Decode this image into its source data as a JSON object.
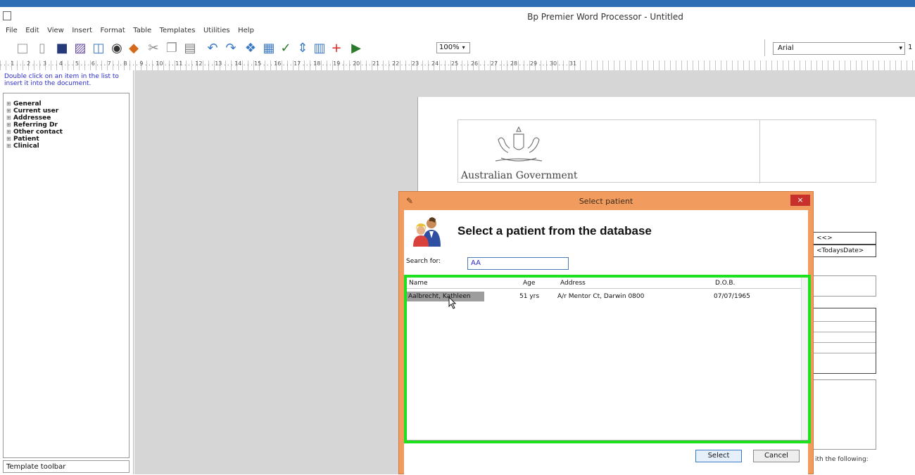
{
  "window": {
    "title": "Bp Premier Word Processor - Untitled"
  },
  "menu": [
    "File",
    "Edit",
    "View",
    "Insert",
    "Format",
    "Table",
    "Templates",
    "Utilities",
    "Help"
  ],
  "toolbar": {
    "zoom": "100%",
    "font": "Arial",
    "font_size": "1"
  },
  "ruler": {
    "marks": ". . . 1 . . . 2 . . . 3 . . . 4 . . . 5 . . . 6 . . . 7 . . . 8 . . . 9 . . . 10 . . . 11 . . . 12 . . . 13 . . . 14 . . . 15 . . . 16 . . . 17 . . . 18 . . . 19 . . . 20 . . . 21 . . . 22 . . . 23 . . . 24 . . . 25 . . . 26 . . . 27 . . . 28 . . . 29 . . . 30 . . . 31"
  },
  "left_panel": {
    "hint": "Double click on an item in the list to insert it into the document.",
    "tree": [
      "General",
      "Current user",
      "Addressee",
      "Referring Dr",
      "Other contact",
      "Patient",
      "Clinical"
    ],
    "footer": "Template toolbar"
  },
  "document": {
    "org": "Australian Government",
    "fields": [
      "<<>",
      "<TodaysDate>"
    ],
    "partial_text": "ith the following:"
  },
  "dialog": {
    "title": "Select patient",
    "close": "×",
    "heading": "Select a patient from the database",
    "search_label": "Search for:",
    "search_value": "AA",
    "columns": [
      "Name",
      "Age",
      "Address",
      "D.O.B."
    ],
    "rows": [
      {
        "name": "Aalbrecht, Kathleen",
        "age": "51 yrs",
        "address": "A/r Mentor Ct, Darwin 0800",
        "dob": "07/07/1965"
      }
    ],
    "select_button": "Select",
    "cancel_button": "Cancel"
  }
}
